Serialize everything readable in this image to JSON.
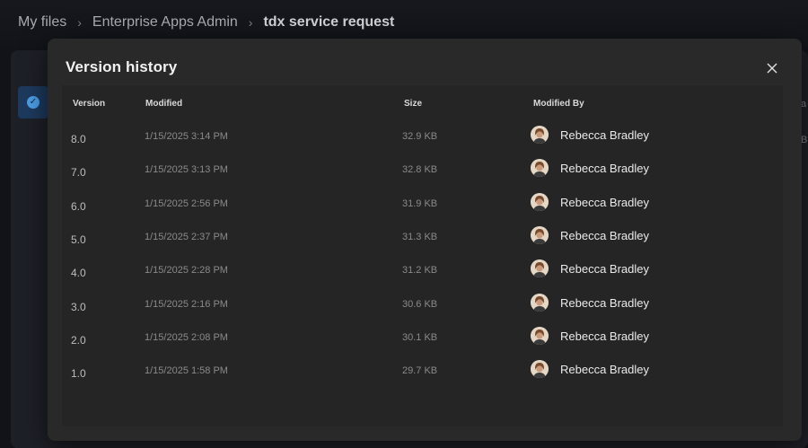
{
  "breadcrumb": {
    "items": [
      "My files",
      "Enterprise Apps Admin"
    ],
    "current": "tdx service request"
  },
  "background": {
    "right_text_1": "a",
    "right_text_2": "Be"
  },
  "dialog": {
    "title": "Version history",
    "columns": {
      "version": "Version",
      "modified": "Modified",
      "size": "Size",
      "modified_by": "Modified By"
    },
    "rows": [
      {
        "version": "8.0",
        "modified": "1/15/2025 3:14 PM",
        "size": "32.9 KB",
        "modified_by": "Rebecca Bradley"
      },
      {
        "version": "7.0",
        "modified": "1/15/2025 3:13 PM",
        "size": "32.8 KB",
        "modified_by": "Rebecca Bradley"
      },
      {
        "version": "6.0",
        "modified": "1/15/2025 2:56 PM",
        "size": "31.9 KB",
        "modified_by": "Rebecca Bradley"
      },
      {
        "version": "5.0",
        "modified": "1/15/2025 2:37 PM",
        "size": "31.3 KB",
        "modified_by": "Rebecca Bradley"
      },
      {
        "version": "4.0",
        "modified": "1/15/2025 2:28 PM",
        "size": "31.2 KB",
        "modified_by": "Rebecca Bradley"
      },
      {
        "version": "3.0",
        "modified": "1/15/2025 2:16 PM",
        "size": "30.6 KB",
        "modified_by": "Rebecca Bradley"
      },
      {
        "version": "2.0",
        "modified": "1/15/2025 2:08 PM",
        "size": "30.1 KB",
        "modified_by": "Rebecca Bradley"
      },
      {
        "version": "1.0",
        "modified": "1/15/2025 1:58 PM",
        "size": "29.7 KB",
        "modified_by": "Rebecca Bradley"
      }
    ]
  },
  "icons": {
    "close": "close-icon",
    "chevron": "chevron-right-icon",
    "check": "checkmark-icon",
    "avatar": "user-avatar"
  },
  "colors": {
    "dialog_bg": "#292929",
    "page_bg": "#111319",
    "accent": "#4ba0e8"
  }
}
